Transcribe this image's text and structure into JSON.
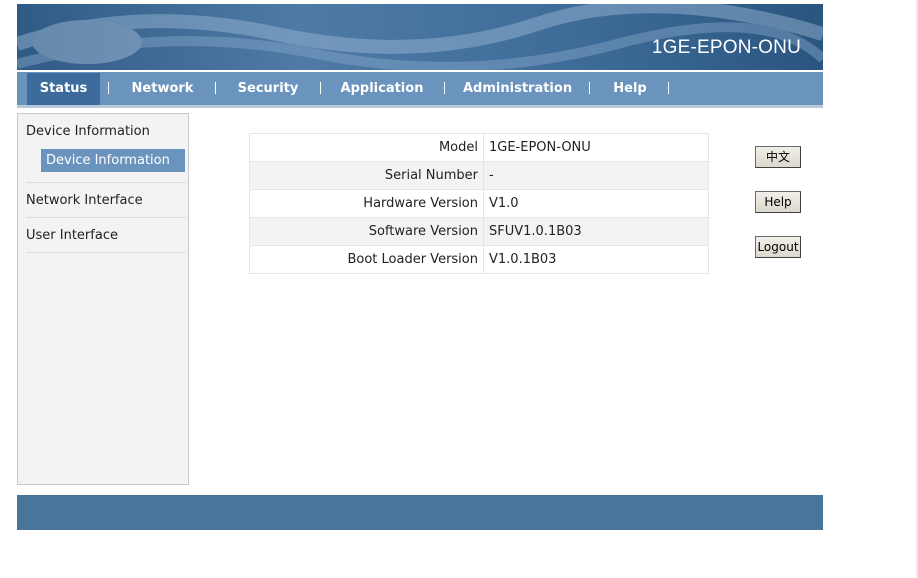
{
  "header": {
    "title": "1GE-EPON-ONU"
  },
  "nav": {
    "tabs": [
      {
        "label": "Status",
        "active": true
      },
      {
        "label": "Network",
        "active": false
      },
      {
        "label": "Security",
        "active": false
      },
      {
        "label": "Application",
        "active": false
      },
      {
        "label": "Administration",
        "active": false
      },
      {
        "label": "Help",
        "active": false
      }
    ]
  },
  "sidebar": {
    "section": "Device Information",
    "active_item": "Device Information",
    "items": [
      {
        "label": "Network Interface"
      },
      {
        "label": "User Interface"
      }
    ]
  },
  "device_info": {
    "rows": [
      {
        "label": "Model",
        "value": "1GE-EPON-ONU"
      },
      {
        "label": "Serial Number",
        "value": "-"
      },
      {
        "label": "Hardware Version",
        "value": "V1.0"
      },
      {
        "label": "Software Version",
        "value": "SFUV1.0.1B03"
      },
      {
        "label": "Boot Loader Version",
        "value": "V1.0.1B03"
      }
    ]
  },
  "buttons": {
    "language": "中文",
    "help": "Help",
    "logout": "Logout"
  },
  "colors": {
    "nav_bar": "#6a93bd",
    "nav_active": "#3d6c9c",
    "footer": "#4a759b",
    "sidebar_active": "#6a93bd"
  }
}
